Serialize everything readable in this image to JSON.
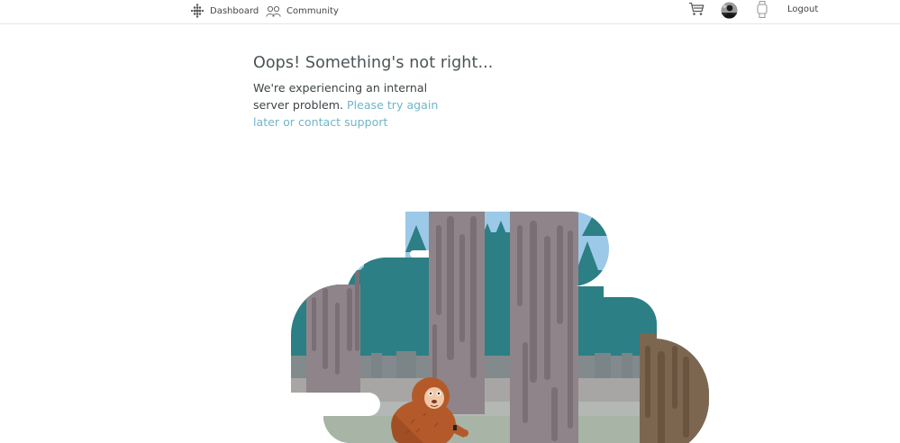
{
  "nav": {
    "dashboard_label": "Dashboard",
    "community_label": "Community",
    "logout_label": "Logout"
  },
  "icons": {
    "dashboard": "fitbit-dots-icon",
    "community": "people-icon",
    "cart": "shopping-cart-icon",
    "avatar": "user-avatar",
    "device": "watch-icon"
  },
  "error": {
    "title": "Oops! Something's not right...",
    "message_text": "We're experiencing an internal server problem.",
    "message_link": "Please try again later or contact support"
  },
  "colors": {
    "link": "#6fb6c9",
    "sky": "#9dc9e8",
    "forest": "#2c7f84",
    "trunk": "#8a7f86",
    "ground": "#a1a4a4",
    "bigfoot": "#b45a2a"
  }
}
